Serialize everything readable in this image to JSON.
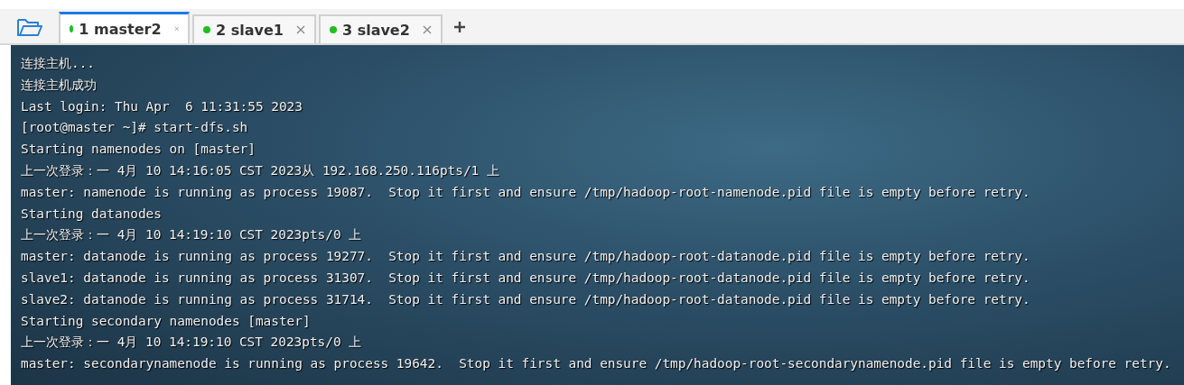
{
  "tabs": [
    {
      "label": "1 master2",
      "selected": true
    },
    {
      "label": "2 slave1",
      "selected": false
    },
    {
      "label": "3 slave2",
      "selected": false
    }
  ],
  "terminal": {
    "lines": [
      "连接主机...",
      "连接主机成功",
      "Last login: Thu Apr  6 11:31:55 2023",
      "[root@master ~]# start-dfs.sh",
      "Starting namenodes on [master]",
      "上一次登录：一 4月 10 14:16:05 CST 2023从 192.168.250.116pts/1 上",
      "master: namenode is running as process 19087.  Stop it first and ensure /tmp/hadoop-root-namenode.pid file is empty before retry.",
      "Starting datanodes",
      "上一次登录：一 4月 10 14:19:10 CST 2023pts/0 上",
      "master: datanode is running as process 19277.  Stop it first and ensure /tmp/hadoop-root-datanode.pid file is empty before retry.",
      "slave1: datanode is running as process 31307.  Stop it first and ensure /tmp/hadoop-root-datanode.pid file is empty before retry.",
      "slave2: datanode is running as process 31714.  Stop it first and ensure /tmp/hadoop-root-datanode.pid file is empty before retry.",
      "Starting secondary namenodes [master]",
      "上一次登录：一 4月 10 14:19:10 CST 2023pts/0 上",
      "master: secondarynamenode is running as process 19642.  Stop it first and ensure /tmp/hadoop-root-secondarynamenode.pid file is empty before retry."
    ]
  }
}
